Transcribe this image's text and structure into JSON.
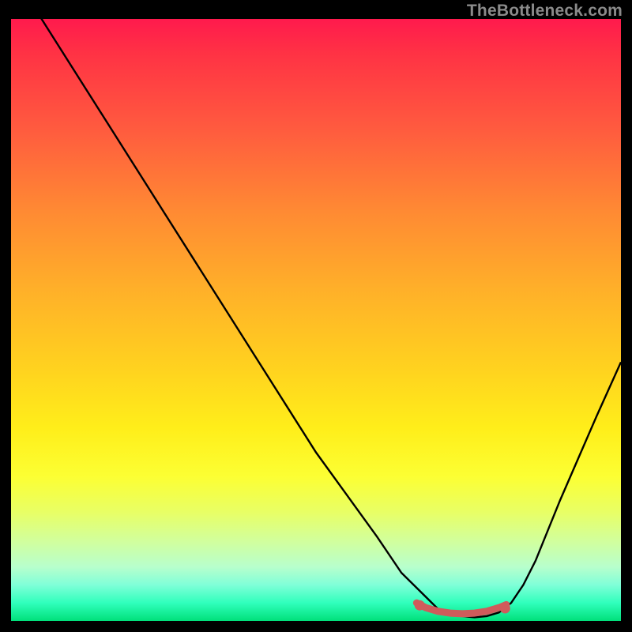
{
  "watermark": "TheBottleneck.com",
  "colors": {
    "frame": "#000000",
    "curve": "#000000",
    "marker": "#cf5b5b",
    "gradient_top": "#ff1a4d",
    "gradient_bottom": "#00e07a"
  },
  "chart_data": {
    "type": "line",
    "title": "",
    "xlabel": "",
    "ylabel": "",
    "xlim": [
      0,
      100
    ],
    "ylim": [
      0,
      100
    ],
    "grid": false,
    "legend": false,
    "series": [
      {
        "name": "bottleneck-curve",
        "x": [
          0,
          5,
          10,
          15,
          20,
          25,
          30,
          35,
          40,
          45,
          50,
          55,
          60,
          64,
          66,
          68,
          70,
          72,
          74,
          76,
          78,
          80,
          82,
          84,
          86,
          88,
          90,
          93,
          96,
          100
        ],
        "values": [
          108,
          100,
          92,
          84,
          76,
          68,
          60,
          52,
          44,
          36,
          28,
          21,
          14,
          8,
          6,
          4,
          2,
          1.2,
          0.8,
          0.6,
          0.8,
          1.4,
          3,
          6,
          10,
          15,
          20,
          27,
          34,
          43
        ]
      }
    ],
    "markers": [
      {
        "name": "optimal-range-start",
        "x": 67,
        "y": 2.6
      },
      {
        "name": "optimal-range-end",
        "x": 81,
        "y": 2.1
      }
    ],
    "optimal_segment": {
      "x": [
        66.5,
        68,
        70,
        72,
        74,
        76,
        78,
        80,
        81.2
      ],
      "values": [
        3.0,
        2.2,
        1.6,
        1.3,
        1.2,
        1.3,
        1.6,
        2.2,
        2.7
      ]
    }
  }
}
